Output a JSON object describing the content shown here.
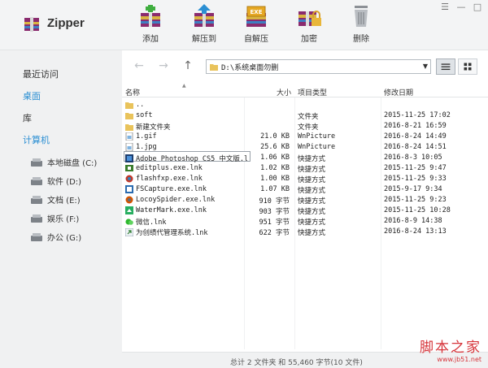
{
  "app": {
    "title": "Zipper"
  },
  "window_controls": [
    "☰",
    "—",
    "□"
  ],
  "toolbar": [
    {
      "label": "添加",
      "icon": "add-archive-icon"
    },
    {
      "label": "解压到",
      "icon": "extract-to-icon"
    },
    {
      "label": "自解压",
      "icon": "self-extract-exe-icon",
      "badge": "EXE"
    },
    {
      "label": "加密",
      "icon": "encrypt-icon"
    },
    {
      "label": "删除",
      "icon": "trash-icon"
    }
  ],
  "sidebar": {
    "items": [
      {
        "label": "最近访问",
        "active": false
      },
      {
        "label": "桌面",
        "active": true
      },
      {
        "label": "库",
        "active": false
      },
      {
        "label": "计算机",
        "active": true
      }
    ],
    "drives": [
      {
        "label": "本地磁盘 (C:)"
      },
      {
        "label": "软件 (D:)"
      },
      {
        "label": "文档 (E:)"
      },
      {
        "label": "娱乐 (F:)"
      },
      {
        "label": "办公 (G:)"
      }
    ]
  },
  "address": {
    "path": "D:\\系统桌面勿删"
  },
  "columns": {
    "name": "名称",
    "size": "大小",
    "type": "项目类型",
    "date": "修改日期"
  },
  "files": [
    {
      "name": "..",
      "size": "",
      "type": "",
      "date": "",
      "icon": "folder-icon"
    },
    {
      "name": "soft",
      "size": "",
      "type": "文件夹",
      "date": "2015-11-25 17:02",
      "icon": "folder-icon"
    },
    {
      "name": "新建文件夹",
      "size": "",
      "type": "文件夹",
      "date": "2016-8-21 16:59",
      "icon": "folder-icon"
    },
    {
      "name": "1.gif",
      "size": "21.0 KB",
      "type": "WnPicture",
      "date": "2016-8-24 14:49",
      "icon": "image-file-icon"
    },
    {
      "name": "1.jpg",
      "size": "25.6 KB",
      "type": "WnPicture",
      "date": "2016-8-24 14:51",
      "icon": "image-file-icon"
    },
    {
      "name": "Adobe Photoshop CS5 中文版.lnk",
      "size": "1.06 KB",
      "type": "快捷方式",
      "date": "2016-8-3 10:05",
      "icon": "photoshop-icon"
    },
    {
      "name": "editplus.exe.lnk",
      "size": "1.02 KB",
      "type": "快捷方式",
      "date": "2015-11-25 9:47",
      "icon": "editplus-icon"
    },
    {
      "name": "flashfxp.exe.lnk",
      "size": "1.00 KB",
      "type": "快捷方式",
      "date": "2015-11-25 9:33",
      "icon": "flashfxp-icon"
    },
    {
      "name": "FSCapture.exe.lnk",
      "size": "1.07 KB",
      "type": "快捷方式",
      "date": "2015-9-17 9:34",
      "icon": "fscapture-icon"
    },
    {
      "name": "LocoySpider.exe.lnk",
      "size": "910 字节",
      "type": "快捷方式",
      "date": "2015-11-25 9:23",
      "icon": "spider-icon"
    },
    {
      "name": "WaterMark.exe.lnk",
      "size": "903 字节",
      "type": "快捷方式",
      "date": "2015-11-25 10:28",
      "icon": "watermark-icon"
    },
    {
      "name": "微信.lnk",
      "size": "951 字节",
      "type": "快捷方式",
      "date": "2016-8-9 14:38",
      "icon": "wechat-icon"
    },
    {
      "name": "为创绩代管理系统.lnk",
      "size": "622 字节",
      "type": "快捷方式",
      "date": "2016-8-24 13:13",
      "icon": "shortcut-icon"
    }
  ],
  "status": {
    "text": "总计 2 文件夹 和  55,460 字节(10 文件)"
  },
  "watermark": {
    "main": "脚本之家",
    "sub": "www.jb51.net"
  }
}
